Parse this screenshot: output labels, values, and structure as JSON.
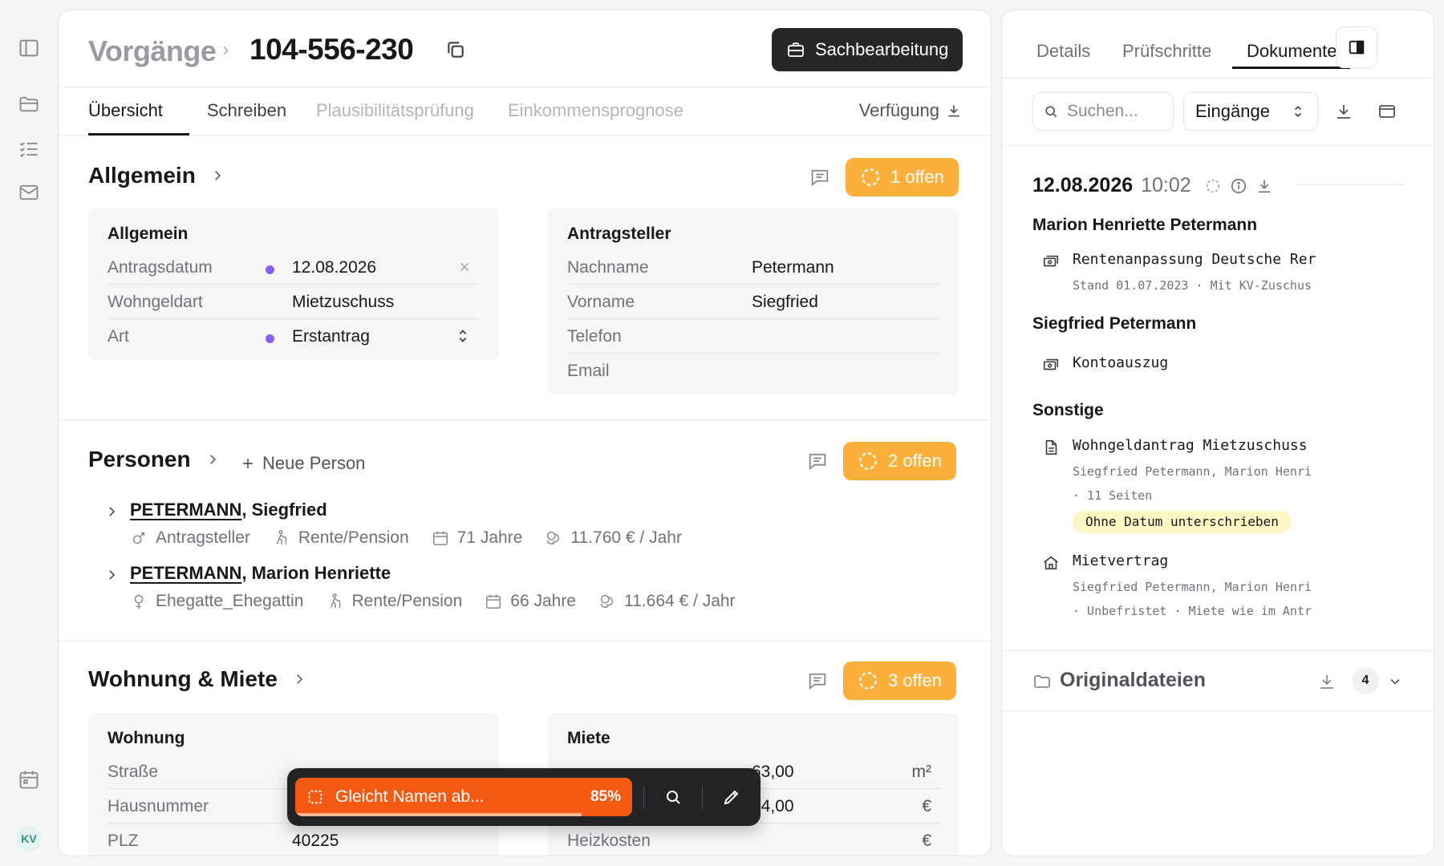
{
  "header": {
    "breadcrumb": "Vorgänge",
    "case_id": "104-556-230",
    "role_button": "Sachbearbeitung"
  },
  "tabs": [
    "Übersicht",
    "Schreiben",
    "Plausibilitätsprüfung",
    "Einkommensprognose"
  ],
  "tab_right": "Verfügung",
  "sections": {
    "allgemein": {
      "title": "Allgemein",
      "badge": "1 offen",
      "card_left": {
        "title": "Allgemein",
        "rows": [
          {
            "label": "Antragsdatum",
            "value": "12.08.2026"
          },
          {
            "label": "Wohngeldart",
            "value": "Mietzuschuss"
          },
          {
            "label": "Art",
            "value": "Erstantrag"
          }
        ]
      },
      "card_right": {
        "title": "Antragsteller",
        "rows": [
          {
            "label": "Nachname",
            "value": "Petermann"
          },
          {
            "label": "Vorname",
            "value": "Siegfried"
          },
          {
            "label": "Telefon",
            "value": ""
          },
          {
            "label": "Email",
            "value": ""
          }
        ]
      }
    },
    "personen": {
      "title": "Personen",
      "new_person": "Neue Person",
      "badge": "2 offen",
      "persons": [
        {
          "last": "PETERMANN",
          "first": ", Siegfried",
          "role": "Antragsteller",
          "income_type": "Rente/Pension",
          "age": "71 Jahre",
          "income": "11.760 € / Jahr"
        },
        {
          "last": "PETERMANN",
          "first": ", Marion Henriette",
          "role": "Ehegatte_Ehegattin",
          "income_type": "Rente/Pension",
          "age": "66 Jahre",
          "income": "11.664 € / Jahr"
        }
      ]
    },
    "wohnung": {
      "title": "Wohnung & Miete",
      "badge": "3 offen",
      "card_left": {
        "title": "Wohnung",
        "rows": [
          {
            "label": "Straße",
            "value": ""
          },
          {
            "label": "Hausnummer",
            "value": ""
          },
          {
            "label": "PLZ",
            "value": "40225"
          }
        ]
      },
      "card_right": {
        "title": "Miete",
        "rows": [
          {
            "label": "",
            "value": "63,00",
            "unit": "m²"
          },
          {
            "label": "",
            "value": "04,00",
            "unit": "€"
          },
          {
            "label": "Heizkosten",
            "value": "",
            "unit": "€"
          }
        ]
      }
    }
  },
  "floating_bar": {
    "label": "Gleicht Namen ab...",
    "percent": "85%",
    "progress": 0.85
  },
  "right_panel": {
    "tabs": [
      "Details",
      "Prüfschritte",
      "Dokumente"
    ],
    "search_placeholder": "Suchen...",
    "filter": "Eingänge",
    "date": "12.08.2026",
    "time": "10:02",
    "groups": [
      {
        "title": "Marion Henriette Petermann",
        "docs": [
          {
            "icon": "money-icon",
            "title": "Rentenanpassung Deutsche Rer",
            "sub1": "Stand 01.07.2023 · Mit KV-Zuschus"
          }
        ]
      },
      {
        "title": "Siegfried Petermann",
        "docs": [
          {
            "icon": "money-icon",
            "title": "Kontoauszug"
          }
        ]
      },
      {
        "title": "Sonstige",
        "docs": [
          {
            "icon": "document-icon",
            "title": "Wohngeldantrag Mietzuschuss",
            "sub1": "Siegfried Petermann, Marion Henri",
            "sub2": "· 11 Seiten",
            "tag": "Ohne Datum unterschrieben"
          },
          {
            "icon": "home-icon",
            "title": "Mietvertrag",
            "sub1": "Siegfried Petermann, Marion Henri",
            "sub2": "· Unbefristet · Miete wie im Antr"
          }
        ]
      }
    ],
    "originals": {
      "title": "Originaldateien",
      "count": "4"
    }
  },
  "user": {
    "initials": "KV"
  },
  "colors": {
    "accent_badge": "#fbb03b",
    "float_pill": "#f35b14",
    "status_dot": "#8b5cf6",
    "tag_bg": "#fdf7c4"
  }
}
